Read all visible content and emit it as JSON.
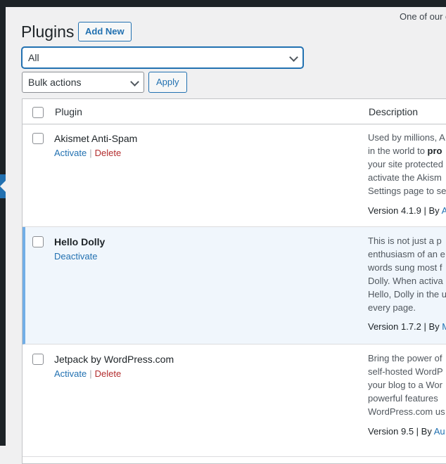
{
  "topbar": {
    "text": "... ... ..."
  },
  "promo": {
    "text": "One of our c"
  },
  "page": {
    "title": "Plugins",
    "add_new": "Add New"
  },
  "filter": {
    "selected": "All"
  },
  "bulk": {
    "selected": "Bulk actions",
    "apply": "Apply"
  },
  "table": {
    "headers": {
      "plugin": "Plugin",
      "description": "Description"
    },
    "rows": [
      {
        "name": "Akismet Anti-Spam",
        "actions": [
          "Activate",
          "Delete"
        ],
        "desc_lines": [
          "Used by millions, A",
          "in the world to ",
          "your site protected",
          "activate the Akism",
          "Settings page to se"
        ],
        "desc_bold": "pro",
        "version": "Version 4.1.9 | By ",
        "author": "A"
      },
      {
        "name": "Hello Dolly",
        "actions": [
          "Deactivate"
        ],
        "desc_lines": [
          "This is not just a p",
          "enthusiasm of an e",
          "words sung most f",
          "Dolly. When activa",
          "Hello, Dolly in the u",
          "every page."
        ],
        "version": "Version 1.7.2 | By ",
        "author": "M"
      },
      {
        "name": "Jetpack by WordPress.com",
        "actions": [
          "Activate",
          "Delete"
        ],
        "desc_lines": [
          "Bring the power of",
          "self-hosted WordP",
          "your blog to a Wor",
          "powerful features ",
          "WordPress.com us"
        ],
        "version": "Version 9.5 | By ",
        "author": "Au"
      }
    ]
  }
}
